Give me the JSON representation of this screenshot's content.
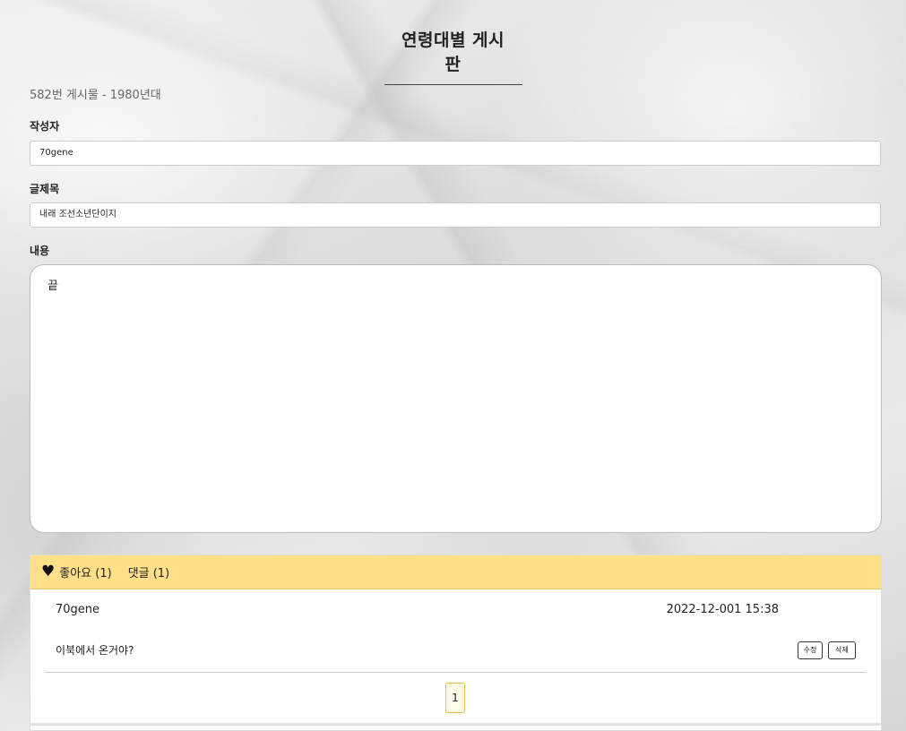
{
  "header": {
    "title": "연령대별 게시판"
  },
  "post": {
    "meta": "582번 게시물 - 1980년대",
    "author_label": "작성자",
    "author_value": "70gene",
    "title_label": "글제목",
    "title_value": "내래 조선소년단이지",
    "content_label": "내용",
    "content_value": "끝"
  },
  "feedback": {
    "like_label": "좋아요 (1)",
    "comment_label": "댓글 (1)",
    "icon": "heart-icon"
  },
  "comments": [
    {
      "author": "70gene",
      "date": "2022-12-001 15:38",
      "text": "이북에서 온거야?",
      "edit_label": "수정",
      "delete_label": "삭제"
    }
  ],
  "pagination": {
    "current_page": "1"
  },
  "colors": {
    "comment_header_bg": "#ffdf88",
    "page_button_border": "#e2c04a"
  }
}
